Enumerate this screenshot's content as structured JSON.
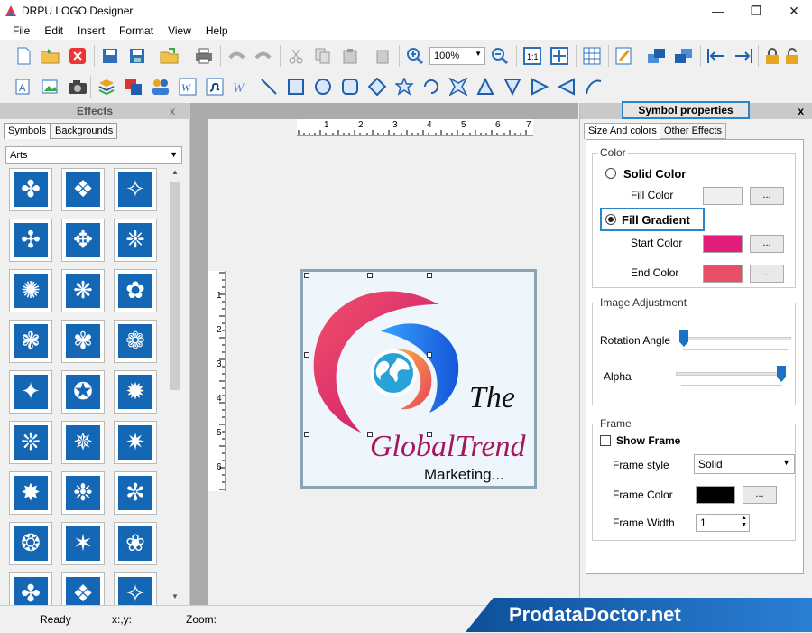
{
  "window": {
    "title": "DRPU LOGO Designer",
    "minimize": "—",
    "maximize": "❐",
    "close": "✕"
  },
  "menu": [
    "File",
    "Edit",
    "Insert",
    "Format",
    "View",
    "Help"
  ],
  "toolbar": {
    "zoom_value": "100%"
  },
  "effects_panel": {
    "title": "Effects",
    "close": "x",
    "tabs": [
      "Symbols",
      "Backgrounds"
    ],
    "category": "Arts"
  },
  "ruler": {
    "h_labels": [
      "1",
      "2",
      "3",
      "4",
      "5",
      "6",
      "7"
    ],
    "v_labels": [
      "1",
      "2",
      "3",
      "4",
      "5",
      "6"
    ]
  },
  "logo": {
    "text_the": "The",
    "text_brand": "GlobalTrend",
    "text_tagline": "Marketing..."
  },
  "symbol_properties": {
    "title": "Symbol properties",
    "close": "x",
    "tabs": [
      "Size And colors",
      "Other Effects"
    ],
    "color_group": "Color",
    "solid_color": "Solid Color",
    "fill_color": "Fill Color",
    "fill_gradient": "Fill Gradient",
    "start_color": "Start Color",
    "end_color": "End Color",
    "dots": "...",
    "image_adjustment": "Image Adjustment",
    "rotation_angle": "Rotation Angle",
    "alpha": "Alpha",
    "frame_group": "Frame",
    "show_frame": "Show Frame",
    "frame_style": "Frame style",
    "frame_style_value": "Solid",
    "frame_color": "Frame Color",
    "frame_width": "Frame Width",
    "frame_width_value": "1"
  },
  "colors": {
    "fill_color": "#efefef",
    "start_color": "#e01e78",
    "end_color": "#e8506a",
    "frame_color": "#000000",
    "accent": "#2a86c9"
  },
  "status": {
    "ready": "Ready",
    "coords": "x:,y:",
    "zoom": "Zoom:"
  },
  "brand": "ProdataDoctor.net"
}
